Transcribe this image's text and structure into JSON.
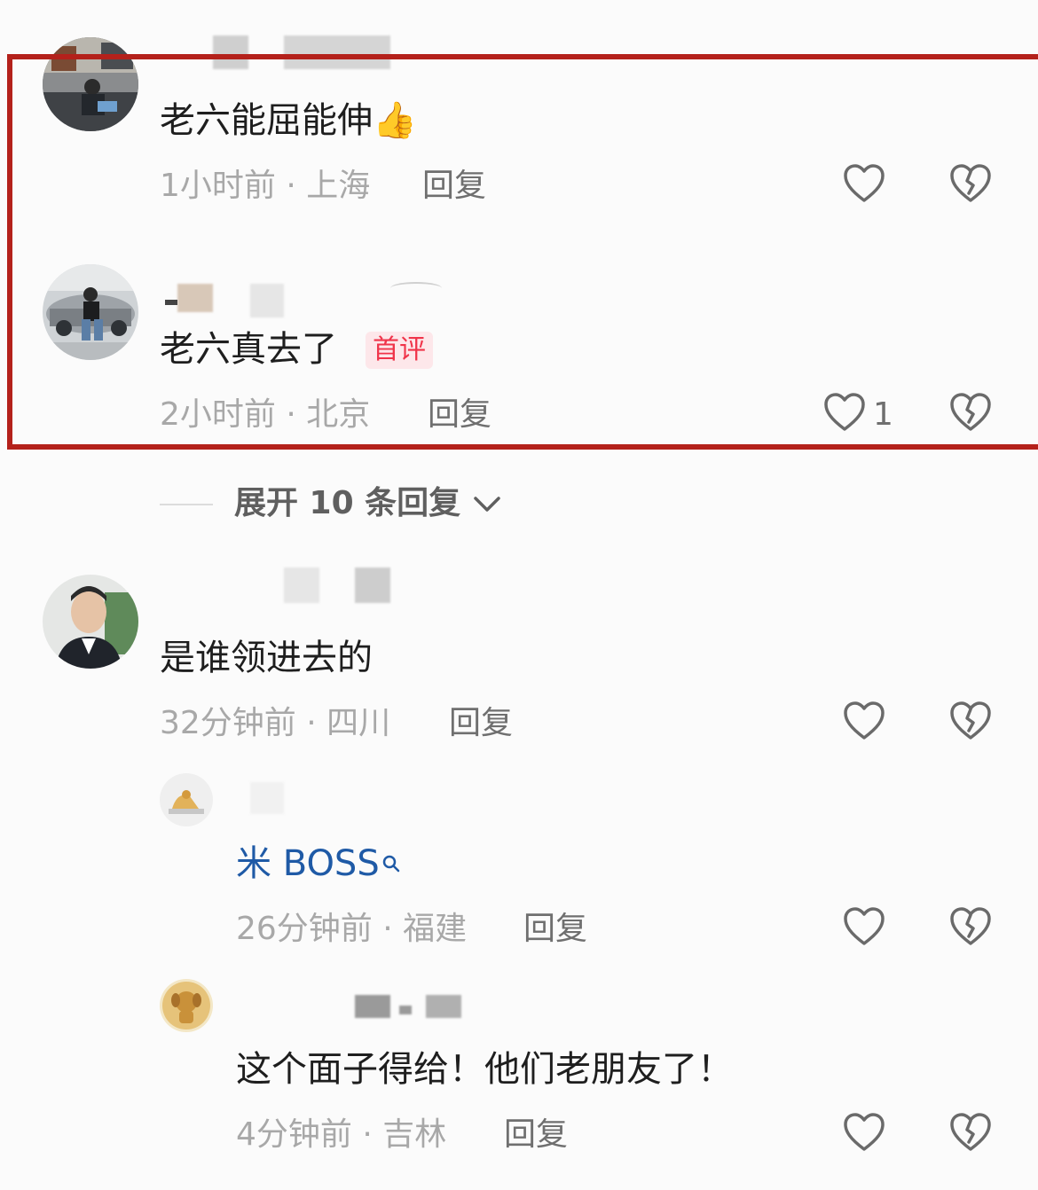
{
  "comments": [
    {
      "text": "老六能屈能伸",
      "emoji": "👍",
      "meta": "1小时前 · 上海",
      "reply_label": "回复"
    },
    {
      "text": "老六真去了",
      "badge": "首评",
      "meta": "2小时前 · 北京",
      "reply_label": "回复",
      "like_count": "1"
    },
    {
      "text": "是谁领进去的",
      "meta": "32分钟前 · 四川",
      "reply_label": "回复"
    }
  ],
  "expand_replies": {
    "label": "展开 10 条回复",
    "chevron": "chevron-down-icon"
  },
  "replies": [
    {
      "mention_text": "米 BOSS",
      "meta": "26分钟前 · 福建",
      "reply_label": "回复"
    },
    {
      "text": "这个面子得给！他们老朋友了！",
      "meta": "4分钟前 · 吉林",
      "reply_label": "回复"
    }
  ],
  "icons": {
    "like": "heart-icon",
    "dislike": "broken-heart-icon",
    "search": "search-icon"
  },
  "colors": {
    "highlight_border": "#b4211b",
    "badge_text": "#f0344a",
    "mention": "#1f5aa6",
    "meta": "#a8a8a8"
  }
}
